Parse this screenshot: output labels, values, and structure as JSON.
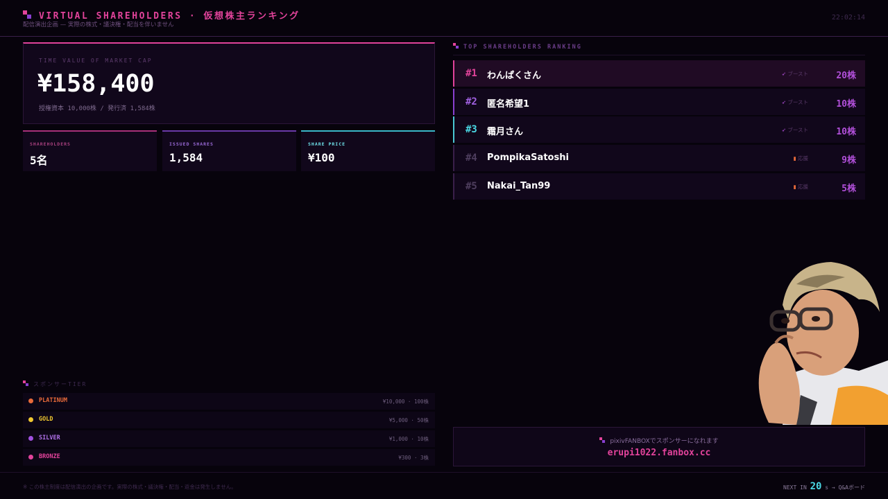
{
  "header": {
    "title": "VIRTUAL SHAREHOLDERS · 仮想株主ランキング",
    "subtitle": "配信演出企画 — 実際の株式・議決権・配当を伴いません",
    "clock": "22:02:14"
  },
  "market_cap": {
    "label": "TIME VALUE OF MARKET CAP",
    "value": "¥158,400",
    "detail": "授権資本 10,000株 / 発行済 1,584株"
  },
  "stats": [
    {
      "label": "SHAREHOLDERS",
      "value": "5名"
    },
    {
      "label": "ISSUED SHARES",
      "value": "1,584"
    },
    {
      "label": "SHARE PRICE",
      "value": "¥100"
    }
  ],
  "ranking": {
    "title": "TOP SHAREHOLDERS RANKING",
    "rows": [
      {
        "rank": "#1",
        "name": "わんぱくさん",
        "tag": "ブースト",
        "shares": "20株"
      },
      {
        "rank": "#2",
        "name": "匿名希望1",
        "tag": "ブースト",
        "shares": "10株"
      },
      {
        "rank": "#3",
        "name": "霜月さん",
        "tag": "ブースト",
        "shares": "10株"
      },
      {
        "rank": "#4",
        "name": "PompikaSatoshi",
        "tag": "応援",
        "shares": "9株"
      },
      {
        "rank": "#5",
        "name": "Nakai_Tan99",
        "tag": "応援",
        "shares": "5株"
      }
    ]
  },
  "tiers": {
    "title": "スポンサーTIER",
    "items": [
      {
        "name": "PLATINUM",
        "price": "¥10,000 · 100株",
        "color": "#e86a3a"
      },
      {
        "name": "GOLD",
        "price": "¥5,000 · 50株",
        "color": "#f0c830"
      },
      {
        "name": "SILVER",
        "price": "¥1,000 · 10株",
        "color": "#a050e0"
      },
      {
        "name": "BRONZE",
        "price": "¥300 · 3株",
        "color": "#e2439b"
      }
    ]
  },
  "fanbox": {
    "label": "pixivFANBOXでスポンサーになれます",
    "url": "erupi1022.fanbox.cc"
  },
  "footer": {
    "note": "※ この株主制度は配信演出の企画です。実際の株式・議決権・配当・返金は発生しません。",
    "next_label": "NEXT IN",
    "countdown": "20",
    "next_suffix": "s → Q&Aボード"
  },
  "icons": {
    "boost": "rocket-icon",
    "support": "bars-icon"
  },
  "colors": {
    "accent": "#e2439b",
    "purple": "#8a3fd1",
    "cyan": "#4ad8e4"
  }
}
